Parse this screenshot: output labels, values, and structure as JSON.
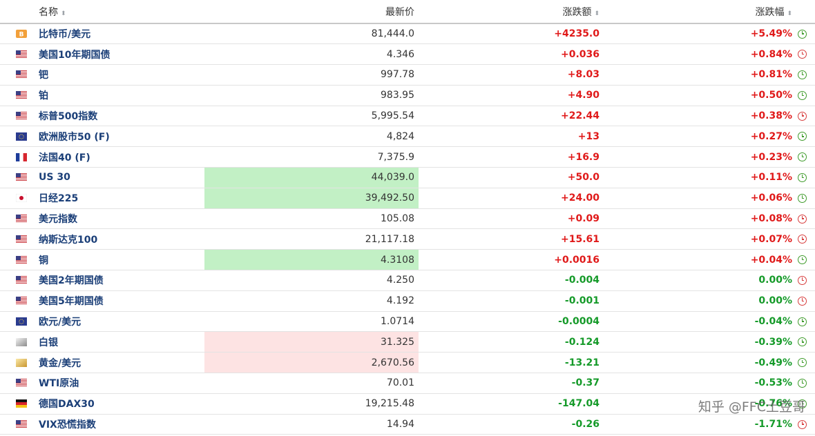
{
  "header": {
    "name": "名称",
    "last": "最新价",
    "change": "涨跌额",
    "change_pct": "涨跌幅",
    "sort_glyph": "⬍"
  },
  "rows": [
    {
      "flag": "bitcoin",
      "name": "比特币/美元",
      "last": "81,444.0",
      "change": "+4235.0",
      "change_pct": "+5.49%",
      "direction": "up",
      "clock": "green",
      "highlight": ""
    },
    {
      "flag": "us",
      "name": "美国10年期国债",
      "last": "4.346",
      "change": "+0.036",
      "change_pct": "+0.84%",
      "direction": "up",
      "clock": "red",
      "highlight": ""
    },
    {
      "flag": "us",
      "name": "钯",
      "last": "997.78",
      "change": "+8.03",
      "change_pct": "+0.81%",
      "direction": "up",
      "clock": "green",
      "highlight": ""
    },
    {
      "flag": "us",
      "name": "铂",
      "last": "983.95",
      "change": "+4.90",
      "change_pct": "+0.50%",
      "direction": "up",
      "clock": "green",
      "highlight": ""
    },
    {
      "flag": "us",
      "name": "标普500指数",
      "last": "5,995.54",
      "change": "+22.44",
      "change_pct": "+0.38%",
      "direction": "up",
      "clock": "red",
      "highlight": ""
    },
    {
      "flag": "eu",
      "name": "欧洲股市50 (F)",
      "last": "4,824",
      "change": "+13",
      "change_pct": "+0.27%",
      "direction": "up",
      "clock": "green",
      "highlight": ""
    },
    {
      "flag": "fr",
      "name": "法国40 (F)",
      "last": "7,375.9",
      "change": "+16.9",
      "change_pct": "+0.23%",
      "direction": "up",
      "clock": "green",
      "highlight": ""
    },
    {
      "flag": "us",
      "name": "US 30",
      "last": "44,039.0",
      "change": "+50.0",
      "change_pct": "+0.11%",
      "direction": "up",
      "clock": "green",
      "highlight": "green"
    },
    {
      "flag": "jp",
      "name": "日经225",
      "last": "39,492.50",
      "change": "+24.00",
      "change_pct": "+0.06%",
      "direction": "up",
      "clock": "green",
      "highlight": "green"
    },
    {
      "flag": "us",
      "name": "美元指数",
      "last": "105.08",
      "change": "+0.09",
      "change_pct": "+0.08%",
      "direction": "up",
      "clock": "red",
      "highlight": ""
    },
    {
      "flag": "us",
      "name": "纳斯达克100",
      "last": "21,117.18",
      "change": "+15.61",
      "change_pct": "+0.07%",
      "direction": "up",
      "clock": "red",
      "highlight": ""
    },
    {
      "flag": "us",
      "name": "铜",
      "last": "4.3108",
      "change": "+0.0016",
      "change_pct": "+0.04%",
      "direction": "up",
      "clock": "green",
      "highlight": "green"
    },
    {
      "flag": "us",
      "name": "美国2年期国债",
      "last": "4.250",
      "change": "-0.004",
      "change_pct": "0.00%",
      "direction": "down",
      "clock": "red",
      "highlight": ""
    },
    {
      "flag": "us",
      "name": "美国5年期国债",
      "last": "4.192",
      "change": "-0.001",
      "change_pct": "0.00%",
      "direction": "down",
      "clock": "red",
      "highlight": ""
    },
    {
      "flag": "eu",
      "name": "欧元/美元",
      "last": "1.0714",
      "change": "-0.0004",
      "change_pct": "-0.04%",
      "direction": "down",
      "clock": "green",
      "highlight": ""
    },
    {
      "flag": "silver",
      "name": "白银",
      "last": "31.325",
      "change": "-0.124",
      "change_pct": "-0.39%",
      "direction": "down",
      "clock": "green",
      "highlight": "red"
    },
    {
      "flag": "gold",
      "name": "黄金/美元",
      "last": "2,670.56",
      "change": "-13.21",
      "change_pct": "-0.49%",
      "direction": "down",
      "clock": "green",
      "highlight": "red"
    },
    {
      "flag": "us",
      "name": "WTI原油",
      "last": "70.01",
      "change": "-0.37",
      "change_pct": "-0.53%",
      "direction": "down",
      "clock": "green",
      "highlight": ""
    },
    {
      "flag": "de",
      "name": "德国DAX30",
      "last": "19,215.48",
      "change": "-147.04",
      "change_pct": "-0.76%",
      "direction": "down",
      "clock": "green",
      "highlight": ""
    },
    {
      "flag": "us",
      "name": "VIX恐慌指数",
      "last": "14.94",
      "change": "-0.26",
      "change_pct": "-1.71%",
      "direction": "down",
      "clock": "red",
      "highlight": ""
    }
  ],
  "watermark": "知乎 @FFC土豆哥",
  "colors": {
    "up": "#e01a1a",
    "down": "#159a29",
    "name": "#1b3f78",
    "highlight_green": "#c2f0c5",
    "highlight_red": "#fde3e3"
  }
}
